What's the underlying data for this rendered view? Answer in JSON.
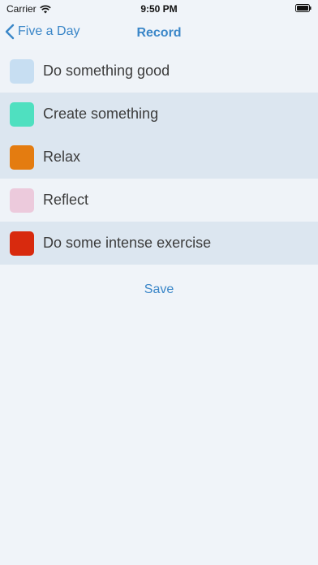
{
  "status_bar": {
    "carrier": "Carrier",
    "time": "9:50 PM",
    "wifi_icon": "wifi-icon",
    "battery_icon": "battery-icon"
  },
  "nav": {
    "back_label": "Five a Day",
    "title": "Record",
    "accent_color": "#3a86c8"
  },
  "activities": [
    {
      "label": "Do something good",
      "color": "#c7def2",
      "selected": false
    },
    {
      "label": "Create something",
      "color": "#4fe0c0",
      "selected": true
    },
    {
      "label": "Relax",
      "color": "#e47c10",
      "selected": true
    },
    {
      "label": "Reflect",
      "color": "#eccadc",
      "selected": false
    },
    {
      "label": "Do some intense exercise",
      "color": "#d82a0e",
      "selected": true
    }
  ],
  "actions": {
    "save_label": "Save"
  }
}
